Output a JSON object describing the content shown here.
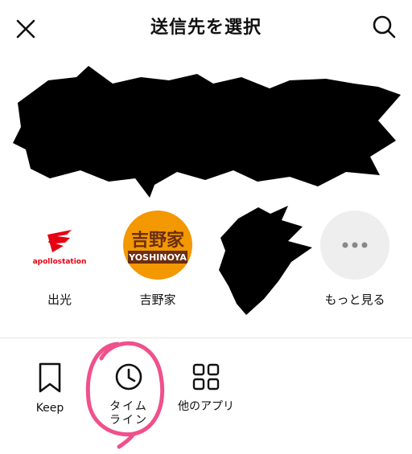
{
  "header": {
    "title": "送信先を選択",
    "close_icon": "close-icon",
    "search_icon": "search-icon"
  },
  "contacts": [
    {
      "name": "出光",
      "logo_text": "apollostation",
      "logo_color": "#e60012"
    },
    {
      "name": "吉野家",
      "logo_text_top": "吉野家",
      "logo_text_bottom": "YOSHINOYA",
      "logo_color": "#f39800"
    },
    {
      "name": ""
    },
    {
      "name": "もっと見る",
      "icon": "more-horizontal-icon"
    }
  ],
  "apps": [
    {
      "label": "Keep",
      "icon": "bookmark-icon"
    },
    {
      "label": "タイム\nライン",
      "line1": "タイム",
      "line2": "ライン",
      "icon": "clock-icon"
    },
    {
      "label": "他のアプリ",
      "icon": "grid-icon"
    }
  ],
  "colors": {
    "annotation": "#f0508c",
    "redaction": "#000000",
    "more_bg": "#eeeeee"
  }
}
